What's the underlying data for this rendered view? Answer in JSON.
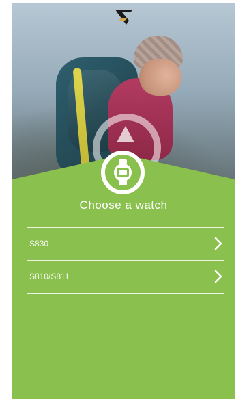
{
  "header": {
    "logo_icon": "brand-logo-icon"
  },
  "hero": {
    "badge_icon": "watch-icon",
    "accent_color": "#8ac04d"
  },
  "title": "Choose a watch",
  "watches": [
    {
      "label": "S830"
    },
    {
      "label": "S810/S811"
    }
  ]
}
